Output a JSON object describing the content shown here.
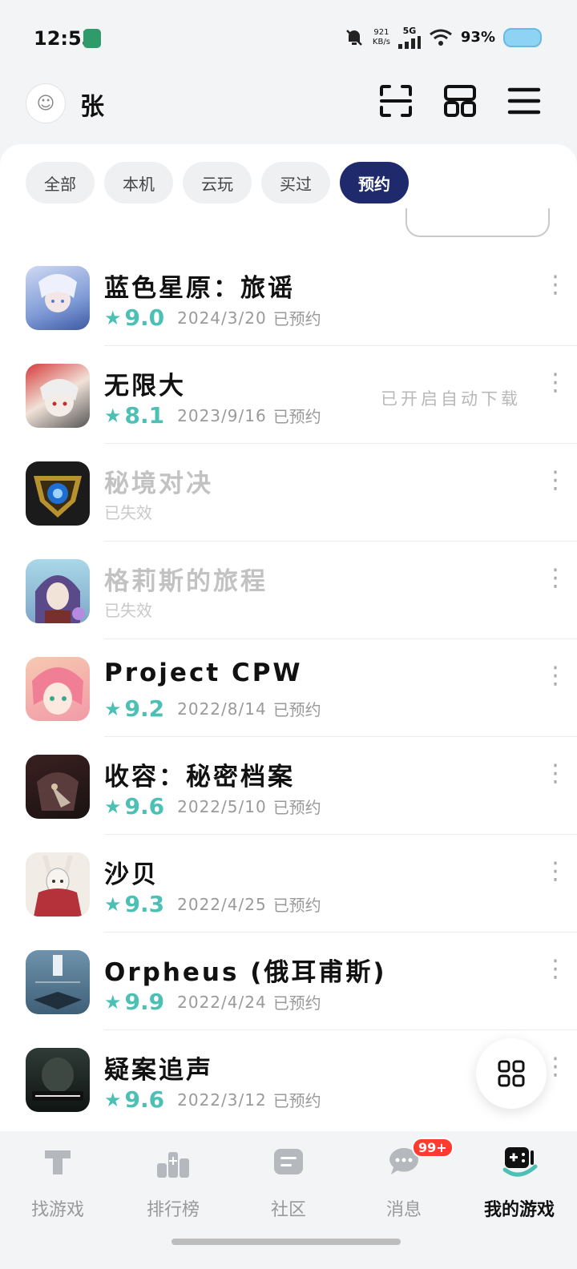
{
  "status": {
    "time": "12:53",
    "net_speed_value": "921",
    "net_speed_unit": "KB/s",
    "network": "5G",
    "battery": "93%"
  },
  "header": {
    "user_name": "张"
  },
  "filters": [
    {
      "label": "全部"
    },
    {
      "label": "本机"
    },
    {
      "label": "云玩"
    },
    {
      "label": "买过"
    },
    {
      "label": "预约"
    }
  ],
  "games": [
    {
      "name": "蓝色星原：旅谣",
      "rating": "9.0",
      "date": "2024/3/20",
      "status": "已预约",
      "note": ""
    },
    {
      "name": "无限大",
      "rating": "8.1",
      "date": "2023/9/16",
      "status": "已预约",
      "note": "已开启自动下载"
    },
    {
      "name": "秘境对决",
      "rating": "",
      "date": "",
      "status": "已失效",
      "note": ""
    },
    {
      "name": "格莉斯的旅程",
      "rating": "",
      "date": "",
      "status": "已失效",
      "note": ""
    },
    {
      "name": "Project CPW",
      "rating": "9.2",
      "date": "2022/8/14",
      "status": "已预约",
      "note": ""
    },
    {
      "name": "收容：秘密档案",
      "rating": "9.6",
      "date": "2022/5/10",
      "status": "已预约",
      "note": ""
    },
    {
      "name": "沙贝",
      "rating": "9.3",
      "date": "2022/4/25",
      "status": "已预约",
      "note": ""
    },
    {
      "name": "Orpheus (俄耳甫斯)",
      "rating": "9.9",
      "date": "2022/4/24",
      "status": "已预约",
      "note": ""
    },
    {
      "name": "疑案追声",
      "rating": "9.6",
      "date": "2022/3/12",
      "status": "已预约",
      "note": ""
    }
  ],
  "nav": {
    "find": "找游戏",
    "rank": "排行榜",
    "community": "社区",
    "messages": "消息",
    "messages_badge": "99+",
    "mine": "我的游戏"
  },
  "colors": {
    "accent": "#4dc0b5",
    "active_chip": "#1e2a6b",
    "badge": "#ff3b30"
  }
}
